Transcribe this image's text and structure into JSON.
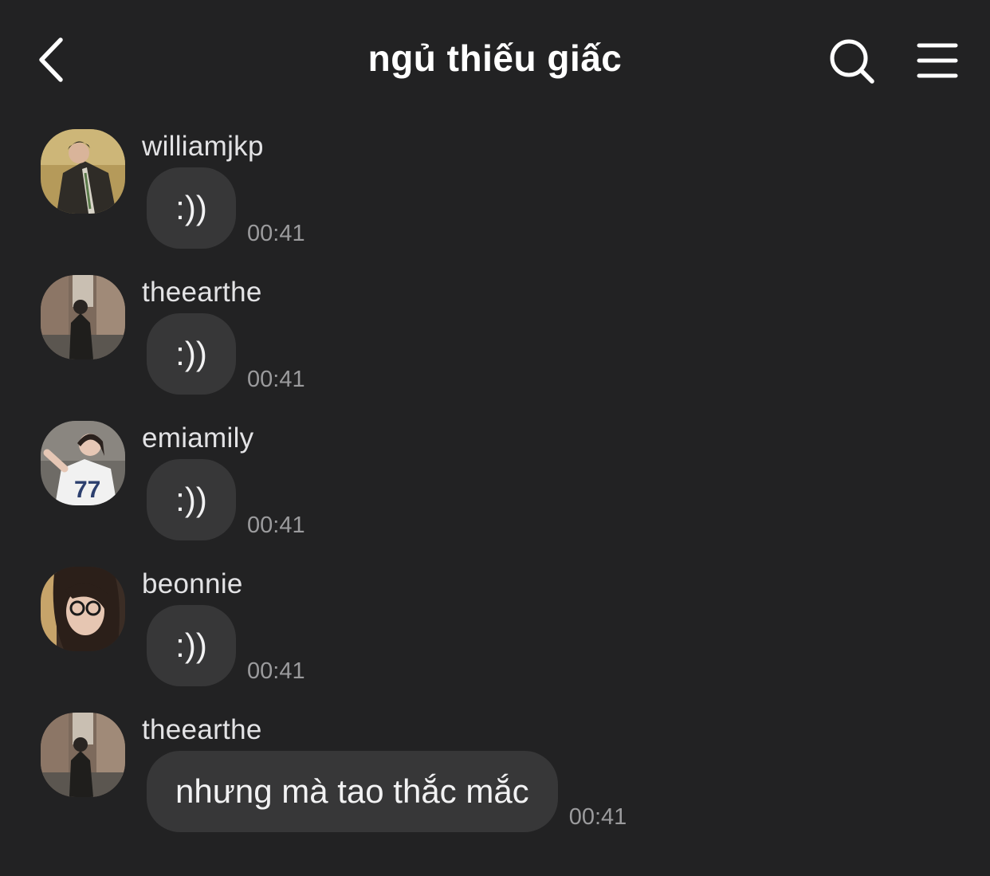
{
  "header": {
    "title": "ngủ thiếu giấc",
    "back_icon": "chevron-left-icon",
    "search_icon": "search-icon",
    "menu_icon": "hamburger-menu-icon"
  },
  "messages": [
    {
      "sender": "williamjkp",
      "text": ":))",
      "time": "00:41"
    },
    {
      "sender": "theearthe",
      "text": ":))",
      "time": "00:41"
    },
    {
      "sender": "emiamily",
      "text": ":))",
      "time": "00:41"
    },
    {
      "sender": "beonnie",
      "text": ":))",
      "time": "00:41"
    },
    {
      "sender": "theearthe",
      "text": "nhưng mà tao thắc mắc",
      "time": "00:41"
    }
  ],
  "colors": {
    "background": "#222223",
    "bubble": "#373738",
    "timestamp": "#9b9b9d"
  }
}
